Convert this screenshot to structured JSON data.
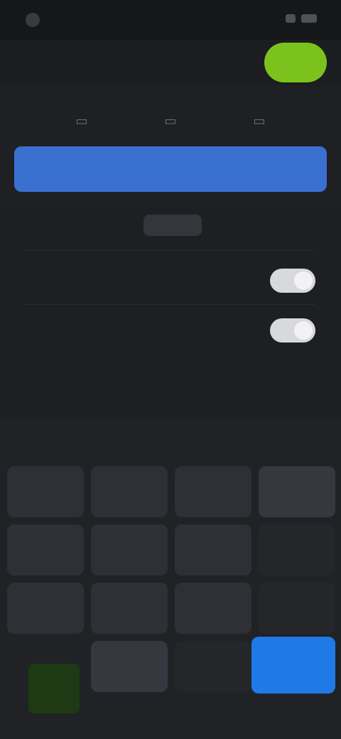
{
  "status_bar": {
    "time": "",
    "signal_icon": "signal-icon",
    "battery_icon": "battery-icon"
  },
  "header": {
    "title": "",
    "go_label": ""
  },
  "toolbar": {
    "labels": []
  },
  "tabs": [
    {
      "label": "",
      "icon": "tab-icon"
    },
    {
      "label": "",
      "icon": "tab-icon"
    },
    {
      "label": "",
      "icon": "tab-icon"
    }
  ],
  "banner": {
    "label": ""
  },
  "settings": {
    "row1_label": "",
    "row1_value": "",
    "row2_label": "",
    "row3_label": "",
    "link_label": ""
  },
  "keypad": {
    "title": "",
    "keys": [
      "",
      "",
      "",
      "",
      "",
      "",
      "",
      "",
      "",
      "",
      "",
      "",
      "",
      "",
      ""
    ]
  },
  "colors": {
    "accent_green": "#7bc21d",
    "accent_blue": "#1f7ae8",
    "banner_blue": "#3a70cf"
  }
}
